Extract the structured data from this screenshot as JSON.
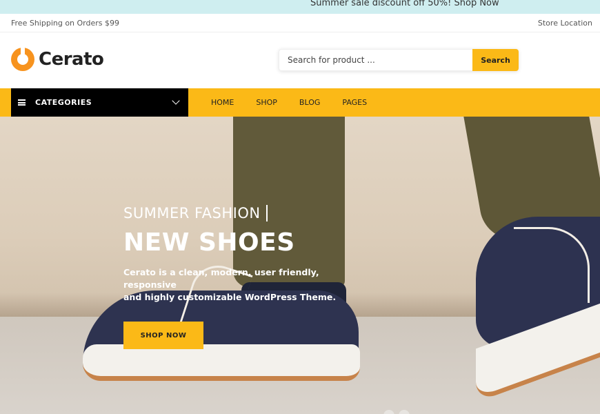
{
  "promo": {
    "text": "Summer sale discount off 50%! Shop Now"
  },
  "topbar": {
    "shipping": "Free Shipping on Orders $99",
    "store": "Store Location"
  },
  "logo": {
    "text": "Cerato"
  },
  "search": {
    "placeholder": "Search for product ...",
    "button": "Search"
  },
  "nav": {
    "categories": "CATEGORIES",
    "items": [
      "HOME",
      "SHOP",
      "BLOG",
      "PAGES"
    ]
  },
  "hero": {
    "subtitle_light": "SUMMER",
    "subtitle_bold": "FASHION",
    "title": "NEW SHOES",
    "desc_line1": "Cerato is a clean, modern, user friendly, responsive",
    "desc_line2": "and highly customizable WordPress Theme.",
    "button": "SHOP NOW"
  },
  "colors": {
    "accent": "#fbb917",
    "nav_dark": "#000000",
    "promo_bg": "#cfeef0",
    "logo_orange": "#f7931e"
  }
}
